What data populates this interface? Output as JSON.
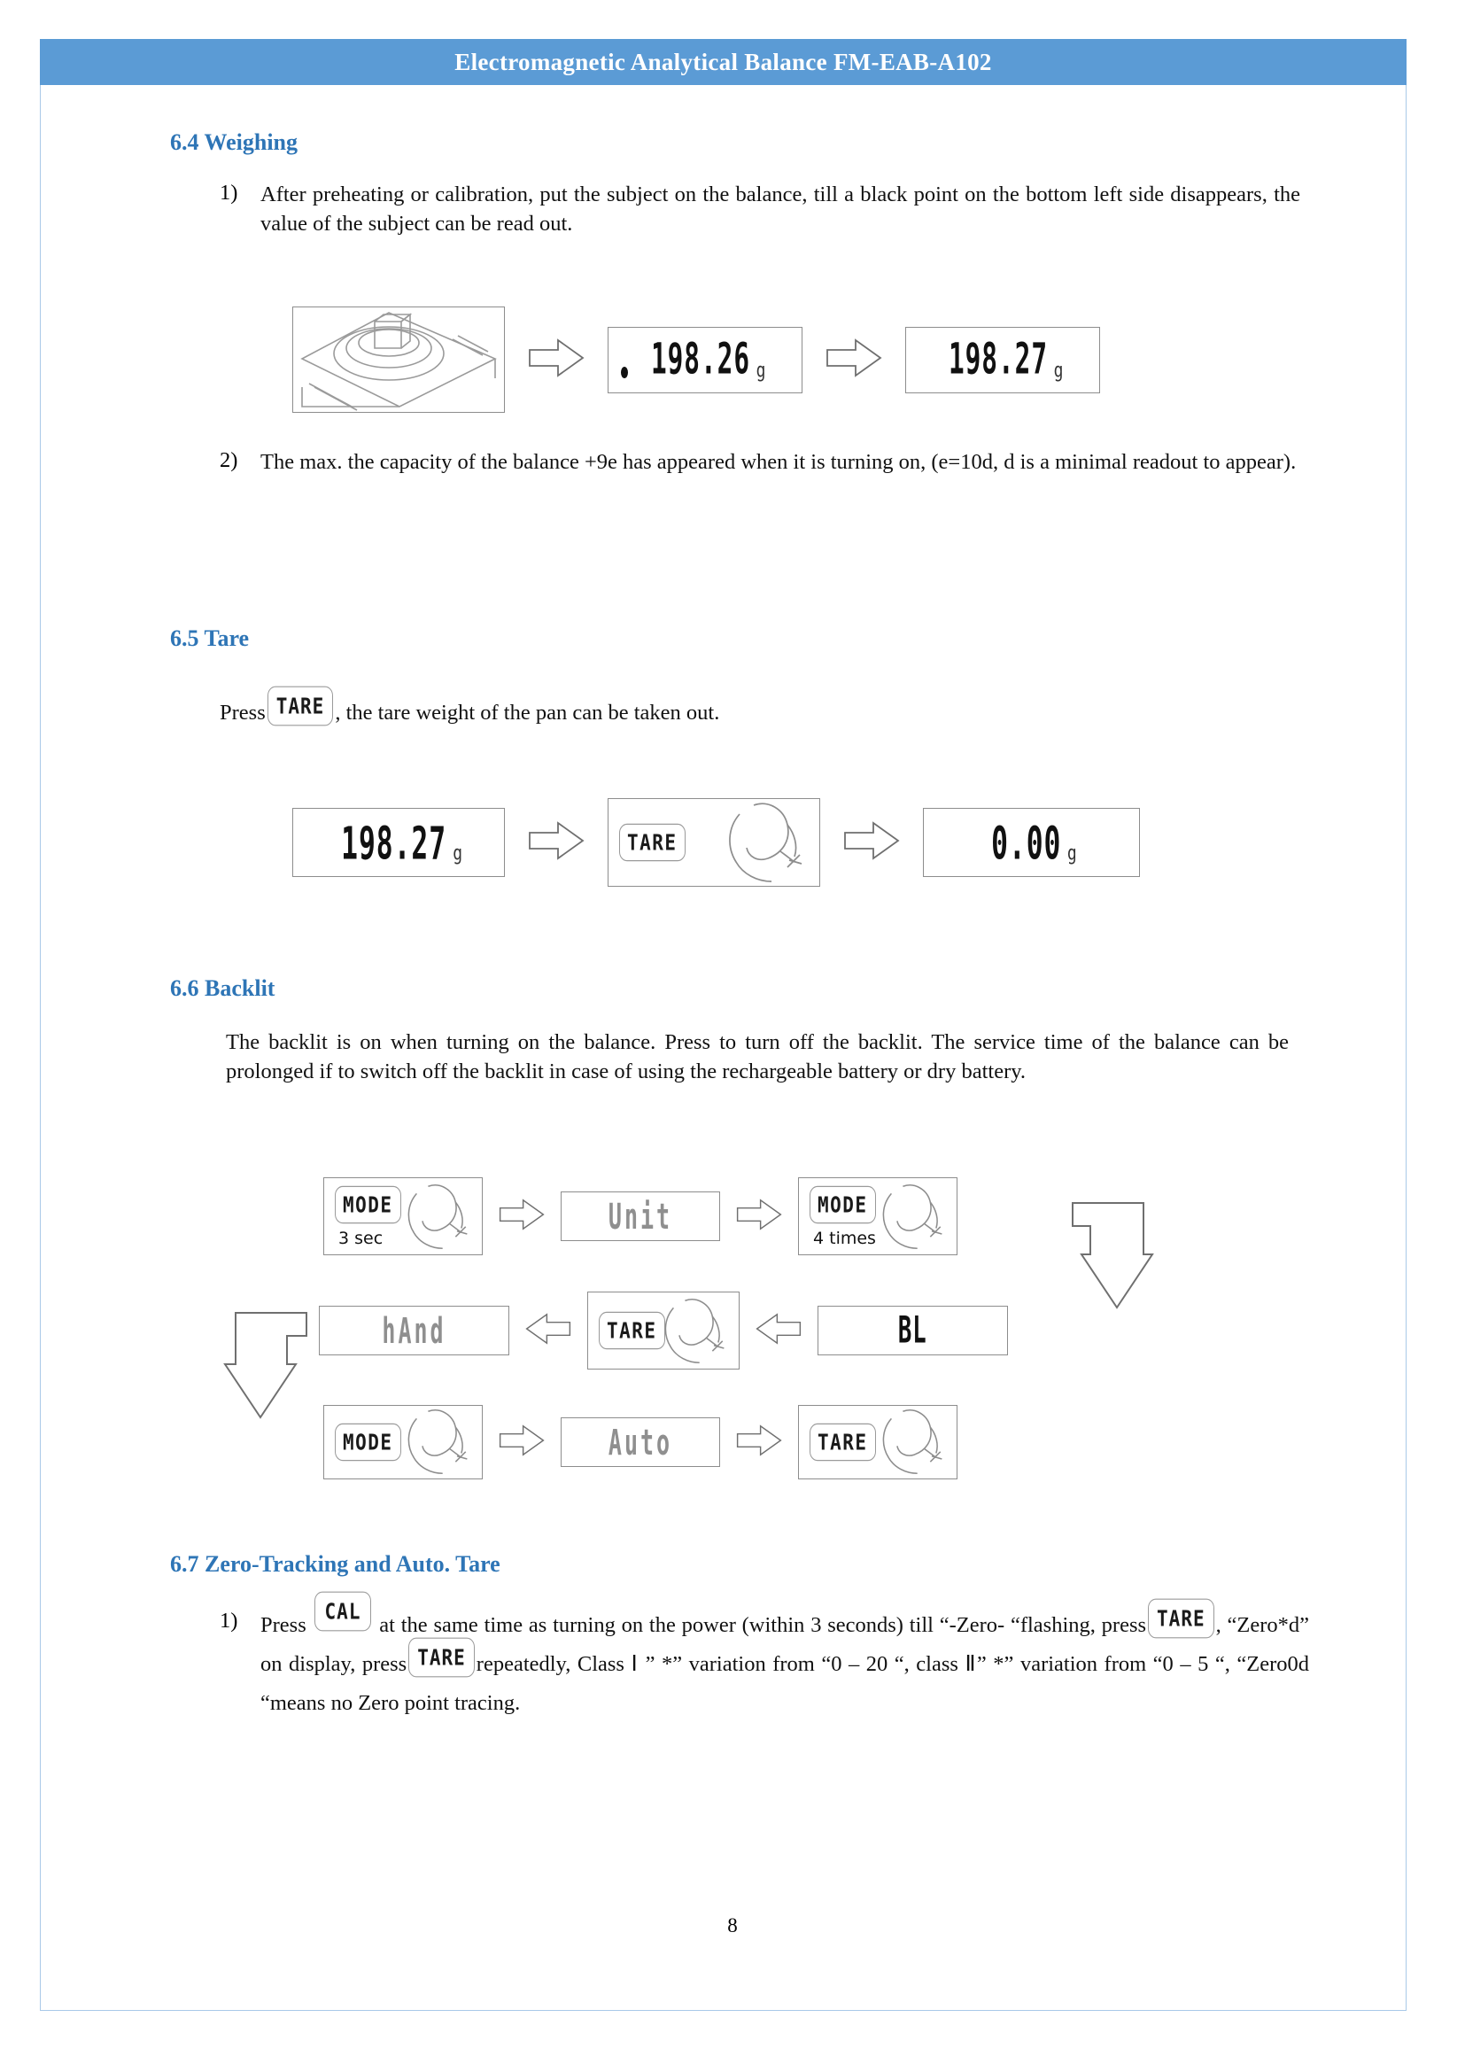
{
  "header": {
    "title": "Electromagnetic Analytical Balance FM-EAB-A102",
    "background_color": "#5b9bd5",
    "text_color": "#ffffff"
  },
  "page": {
    "number": "8",
    "border_color": "#a9c9e8",
    "heading_color": "#2e75b6"
  },
  "sections": {
    "weighing": {
      "heading": "6.4 Weighing",
      "items": [
        {
          "number": "1)",
          "text": "After preheating or calibration, put the subject on the balance, till a black point on the bottom left side disappears, the value of the subject can be read out."
        },
        {
          "number": "2)",
          "text": "The max. the capacity of the balance +9e has appeared when it is turning on, (e=10d, d is a minimal readout to appear)."
        }
      ],
      "figure": {
        "scale_label": "balance-illustration",
        "displays": [
          {
            "value": "198.26",
            "unit": "g",
            "stable_dot": true
          },
          {
            "value": "198.27",
            "unit": "g",
            "stable_dot": false
          }
        ]
      }
    },
    "tare": {
      "heading": "6.5 Tare",
      "text_before": "Press",
      "key": "TARE",
      "text_after": ", the tare weight of the pan can be taken out.",
      "figure": {
        "start_display": {
          "value": "198.27",
          "unit": "g"
        },
        "key_press": "TARE",
        "end_display": {
          "value": "0.00",
          "unit": "g"
        }
      }
    },
    "backlit": {
      "heading": "6.6 Backlit",
      "text": "The backlit is on when turning on the balance. Press to turn off the backlit. The service time of the balance can be prolonged if to switch off the backlit in case of using the rechargeable battery or dry battery.",
      "figure": {
        "row1": [
          {
            "type": "key",
            "label": "MODE",
            "sublabel": "3 sec"
          },
          {
            "type": "arrow",
            "direction": "right"
          },
          {
            "type": "screen",
            "text": "Unit"
          },
          {
            "type": "arrow",
            "direction": "right"
          },
          {
            "type": "key",
            "label": "MODE",
            "sublabel": "4 times"
          }
        ],
        "row2": [
          {
            "type": "screen",
            "text": "hAnd"
          },
          {
            "type": "arrow",
            "direction": "left"
          },
          {
            "type": "key",
            "label": "TARE",
            "sublabel": ""
          },
          {
            "type": "arrow",
            "direction": "left"
          },
          {
            "type": "screen",
            "text": "BL"
          }
        ],
        "row3": [
          {
            "type": "key",
            "label": "MODE",
            "sublabel": ""
          },
          {
            "type": "arrow",
            "direction": "right"
          },
          {
            "type": "screen",
            "text": "Auto"
          },
          {
            "type": "arrow",
            "direction": "right"
          },
          {
            "type": "key",
            "label": "TARE",
            "sublabel": ""
          }
        ]
      }
    },
    "zero_tracking": {
      "heading": "6.7 Zero-Tracking and Auto. Tare",
      "item_number": "1)",
      "t1": "Press",
      "key1": "CAL",
      "t2": "at the same time as turning on the power (within 3 seconds) till “-Zero- “flashing, press",
      "key2": "TARE",
      "t3": ", “Zero*d” on display, press",
      "key3": "TARE",
      "t4": "repeatedly, Class Ⅰ ” *” variation from “0 – 20 “, class Ⅱ” *” variation from “0 – 5 “, “Zero0d “means no Zero point tracing."
    }
  }
}
